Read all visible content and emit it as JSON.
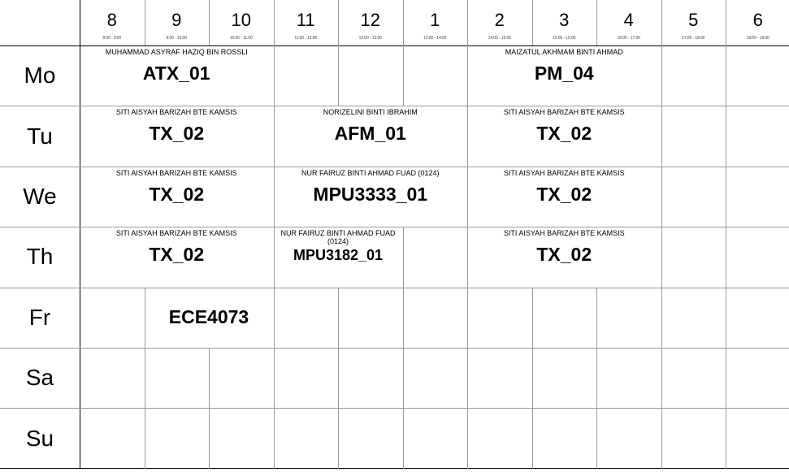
{
  "time_slots": [
    {
      "hour": "8",
      "range": "8:00 - 9:00"
    },
    {
      "hour": "9",
      "range": "9:00 - 10:00"
    },
    {
      "hour": "10",
      "range": "10:00 - 11:00"
    },
    {
      "hour": "11",
      "range": "11:00 - 12:00"
    },
    {
      "hour": "12",
      "range": "12:00 - 13:00"
    },
    {
      "hour": "1",
      "range": "13:00 - 14:00"
    },
    {
      "hour": "2",
      "range": "14:00 - 15:00"
    },
    {
      "hour": "3",
      "range": "15:00 - 16:00"
    },
    {
      "hour": "4",
      "range": "16:00 - 17:00"
    },
    {
      "hour": "5",
      "range": "17:00 - 18:00"
    },
    {
      "hour": "6",
      "range": "18:00 - 19:00"
    }
  ],
  "days": [
    "Mo",
    "Tu",
    "We",
    "Th",
    "Fr",
    "Sa",
    "Su"
  ],
  "courses": [
    {
      "day": 0,
      "start": 0,
      "span": 3,
      "instructor": "MUHAMMAD ASYRAF HAZIQ BIN ROSSLI",
      "code": "ATX_01"
    },
    {
      "day": 0,
      "start": 6,
      "span": 3,
      "instructor": "MAIZATUL AKHMAM BINTI AHMAD",
      "code": "PM_04"
    },
    {
      "day": 1,
      "start": 0,
      "span": 3,
      "instructor": "SITI AISYAH BARIZAH BTE KAMSIS",
      "code": "TX_02"
    },
    {
      "day": 1,
      "start": 3,
      "span": 3,
      "instructor": "NORIZELINI BINTI IBRAHIM",
      "code": "AFM_01"
    },
    {
      "day": 1,
      "start": 6,
      "span": 3,
      "instructor": "SITI AISYAH BARIZAH BTE KAMSIS",
      "code": "TX_02"
    },
    {
      "day": 2,
      "start": 0,
      "span": 3,
      "instructor": "SITI AISYAH BARIZAH BTE KAMSIS",
      "code": "TX_02"
    },
    {
      "day": 2,
      "start": 3,
      "span": 3,
      "instructor": "NUR FAIRUZ BINTI AHMAD FUAD (0124)",
      "code": "MPU3333_01"
    },
    {
      "day": 2,
      "start": 6,
      "span": 3,
      "instructor": "SITI AISYAH BARIZAH BTE KAMSIS",
      "code": "TX_02"
    },
    {
      "day": 3,
      "start": 0,
      "span": 3,
      "instructor": "SITI AISYAH BARIZAH BTE KAMSIS",
      "code": "TX_02"
    },
    {
      "day": 3,
      "start": 3,
      "span": 2,
      "instructor": "NUR FAIRUZ BINTI AHMAD FUAD (0124)",
      "code": "MPU3182_01"
    },
    {
      "day": 3,
      "start": 6,
      "span": 3,
      "instructor": "SITI AISYAH BARIZAH BTE KAMSIS",
      "code": "TX_02"
    },
    {
      "day": 4,
      "start": 1,
      "span": 2,
      "instructor": "",
      "code": "ECE4073"
    }
  ]
}
